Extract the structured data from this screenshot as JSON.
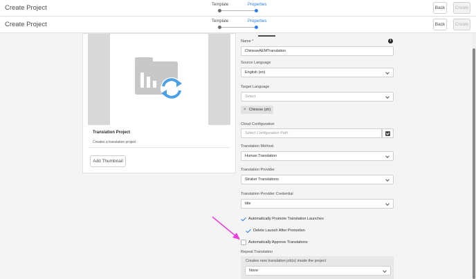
{
  "header": {
    "title": "Create Project",
    "steps": [
      {
        "label": "Template",
        "active": false
      },
      {
        "label": "Properties",
        "active": true
      }
    ],
    "back_label": "Back",
    "create_label": "Create"
  },
  "card": {
    "title": "Translation Project",
    "description": "Creates a translation project",
    "thumbnail_icon": "translation-project-icon",
    "add_thumbnail_label": "Add Thumbnail"
  },
  "form": {
    "name": {
      "label": "Name *",
      "value": "ChineseAEMTranslation",
      "info_icon": "info-icon"
    },
    "source_language": {
      "label": "Source Language",
      "value": "English (en)"
    },
    "target_language": {
      "label": "Target Language",
      "placeholder": "Select",
      "tags": [
        {
          "label": "Chinese (zh)"
        }
      ]
    },
    "cloud_configuration": {
      "label": "Cloud Configuration",
      "placeholder": "Select Configuration Path",
      "picker_icon": "path-picker-icon"
    },
    "translation_method": {
      "label": "Translation Method",
      "value": "Human Translation"
    },
    "translation_provider": {
      "label": "Translation Provider",
      "value": "Straker Translations"
    },
    "provider_credential": {
      "label": "Translation Provider Credential",
      "value": "title"
    },
    "options": [
      {
        "label": "Automatically Promote Translation Launches",
        "checked": true
      },
      {
        "label": "Delete Launch After Promotion",
        "checked": true
      },
      {
        "label": "Automatically Approve Translations",
        "checked": false
      }
    ],
    "repeat_translation": {
      "label": "Repeat Translation",
      "sublabel": "Creates new translation job(s) inside the project",
      "value": "None"
    }
  },
  "colors": {
    "accent": "#2680eb",
    "annotation_arrow": "#e83fdc",
    "thumb_icon_gray": "#c8c8c8",
    "thumb_icon_blue": "#4d9fe6"
  }
}
